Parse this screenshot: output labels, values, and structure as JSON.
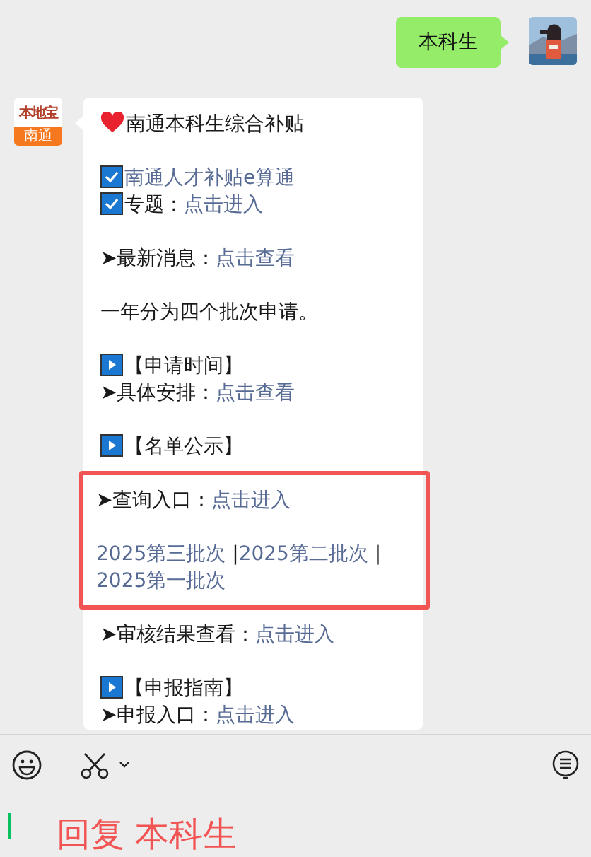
{
  "messages": [
    {
      "kind": "outgoing",
      "text": "本科生"
    },
    {
      "kind": "incoming",
      "avatar": {
        "brand": "本地宝",
        "city": "南通"
      },
      "blocks": [
        {
          "highlighted": false,
          "lines": [
            {
              "kind": "heart",
              "parts": [
                {
                  "text": "南通本科生综合补贴",
                  "link": false
                }
              ]
            }
          ]
        },
        {
          "highlighted": false,
          "lines": [
            {
              "kind": "check",
              "parts": [
                {
                  "text": "南通人才补贴e算通",
                  "link": true
                }
              ]
            },
            {
              "kind": "check",
              "parts": [
                {
                  "text": "专题：",
                  "link": false
                },
                {
                  "text": "点击进入",
                  "link": true
                }
              ]
            }
          ]
        },
        {
          "highlighted": false,
          "lines": [
            {
              "kind": "plain",
              "parts": [
                {
                  "text": "➤最新消息：",
                  "link": false
                },
                {
                  "text": "点击查看",
                  "link": true
                }
              ]
            }
          ]
        },
        {
          "highlighted": false,
          "lines": [
            {
              "kind": "plain",
              "parts": [
                {
                  "text": "一年分为四个批次申请。",
                  "link": false
                }
              ]
            }
          ]
        },
        {
          "highlighted": false,
          "lines": [
            {
              "kind": "play",
              "parts": [
                {
                  "text": "【申请时间】",
                  "link": false
                }
              ]
            },
            {
              "kind": "plain",
              "parts": [
                {
                  "text": "➤具体安排：",
                  "link": false
                },
                {
                  "text": "点击查看",
                  "link": true
                }
              ]
            }
          ]
        },
        {
          "highlighted": false,
          "lines": [
            {
              "kind": "play",
              "parts": [
                {
                  "text": "【名单公示】",
                  "link": false
                }
              ]
            }
          ]
        },
        {
          "highlighted": true,
          "lines": [
            {
              "kind": "plain",
              "parts": [
                {
                  "text": "➤查询入口：",
                  "link": false
                },
                {
                  "text": "点击进入",
                  "link": true
                }
              ]
            },
            {
              "kind": "blank"
            },
            {
              "kind": "plain",
              "parts": [
                {
                  "text": "2025第三批次",
                  "link": true
                },
                {
                  "text": " |",
                  "link": false
                },
                {
                  "text": "2025第二批次",
                  "link": true
                },
                {
                  "text": " |",
                  "link": false
                },
                {
                  "text": " 2025第一批次",
                  "link": true
                }
              ]
            }
          ]
        },
        {
          "highlighted": false,
          "lines": [
            {
              "kind": "plain",
              "parts": [
                {
                  "text": "➤审核结果查看：",
                  "link": false
                },
                {
                  "text": "点击进入",
                  "link": true
                }
              ]
            }
          ]
        },
        {
          "highlighted": false,
          "lines": [
            {
              "kind": "play",
              "parts": [
                {
                  "text": "【申报指南】",
                  "link": false
                }
              ]
            },
            {
              "kind": "plain",
              "parts": [
                {
                  "text": "➤申报入口：",
                  "link": false
                },
                {
                  "text": "点击进入",
                  "link": true
                }
              ]
            }
          ]
        }
      ]
    }
  ],
  "composer": {
    "reply_text": "回复 本科生"
  }
}
